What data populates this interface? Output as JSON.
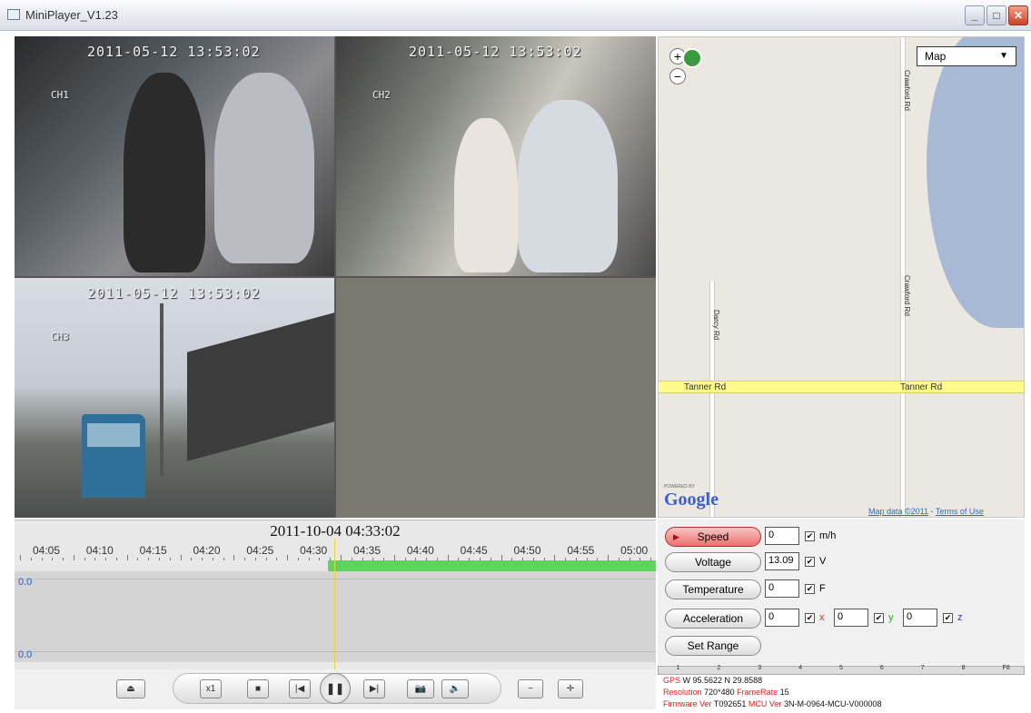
{
  "window": {
    "title": "MiniPlayer_V1.23"
  },
  "videos": [
    {
      "name": "channel-1",
      "timestamp": "2011-05-12 13:53:02",
      "channel": "CH1"
    },
    {
      "name": "channel-2",
      "timestamp": "2011-05-12 13:53:02",
      "channel": "CH2"
    },
    {
      "name": "channel-3",
      "timestamp": "2011-05-12 13:53:02",
      "channel": "CH3"
    },
    {
      "name": "channel-4",
      "timestamp": "",
      "channel": ""
    }
  ],
  "map": {
    "map_type": "Map",
    "zoom_in": "+",
    "zoom_out": "−",
    "roads": {
      "tanner_left": "Tanner Rd",
      "tanner_right": "Tanner Rd",
      "crawford_top": "Crawford Rd",
      "crawford_mid": "Crawford Rd",
      "darcy": "Darcy Rd"
    },
    "powered_by": "POWERED BY",
    "google": "Google",
    "credit_data": "Map data ©2011",
    "credit_sep": " - ",
    "credit_terms": "Terms of Use"
  },
  "timeline": {
    "current": "2011-10-04 04:33:02",
    "ticks": [
      "04:05",
      "04:10",
      "04:15",
      "04:20",
      "04:25",
      "04:30",
      "04:35",
      "04:40",
      "04:45",
      "04:50",
      "04:55",
      "05:00"
    ],
    "y_top": "0.0",
    "y_bottom": "0.0"
  },
  "controls": {
    "eject": "⏏",
    "speed": "x1",
    "stop": "■",
    "prev": "|◀",
    "play_pause": "❚❚",
    "next": "▶|",
    "snapshot": "📷",
    "volume": "🔈",
    "zoom_out": "−",
    "zoom_in": "✛"
  },
  "sensors": {
    "speed": {
      "label": "Speed",
      "value": "0",
      "unit": "m/h"
    },
    "voltage": {
      "label": "Voltage",
      "value": "13.09",
      "unit": "V"
    },
    "temperature": {
      "label": "Temperature",
      "value": "0",
      "unit": "F"
    },
    "acceleration": {
      "label": "Acceleration",
      "x": "0",
      "y": "0",
      "z": "0",
      "x_label": "x",
      "y_label": "y",
      "z_label": "z"
    },
    "set_range": "Set Range",
    "check": "✔"
  },
  "channel_header": [
    "1",
    "2",
    "3",
    "4",
    "5",
    "6",
    "7",
    "8",
    "F8"
  ],
  "info": {
    "gps_label": "GPS",
    "gps_value": "W 95.5622  N 29.8588",
    "resolution_label": "Resolution",
    "resolution_value": "720*480",
    "framerate_label": "FrameRate",
    "framerate_value": "15",
    "firmware_label": "Firmware Ver",
    "firmware_value": "T092651",
    "mcu_label": "MCU Ver",
    "mcu_value": "3N-M-0964-MCU-V000008"
  },
  "colors": {
    "timeline_bar": "#5fd35f",
    "cursor": "#e7d43a",
    "speed_active": "#ef6f6f",
    "map_road": "#fffb8a",
    "lake": "#a8b9d6"
  }
}
